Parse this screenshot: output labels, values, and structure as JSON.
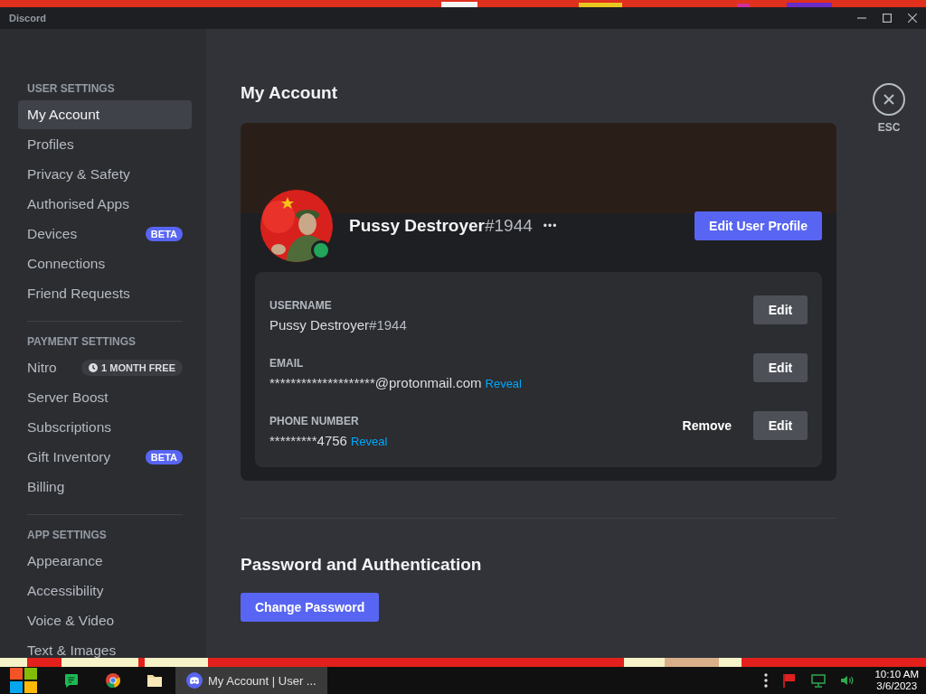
{
  "window": {
    "title": "Discord"
  },
  "sidebar": {
    "sections": [
      {
        "header": "USER SETTINGS",
        "items": [
          {
            "label": "My Account",
            "selected": true
          },
          {
            "label": "Profiles",
            "selected": false
          },
          {
            "label": "Privacy & Safety",
            "selected": false
          },
          {
            "label": "Authorised Apps",
            "selected": false
          },
          {
            "label": "Devices",
            "selected": false,
            "badge": {
              "kind": "beta",
              "text": "BETA"
            }
          },
          {
            "label": "Connections",
            "selected": false
          },
          {
            "label": "Friend Requests",
            "selected": false
          }
        ]
      },
      {
        "header": "PAYMENT SETTINGS",
        "items": [
          {
            "label": "Nitro",
            "selected": false,
            "badge": {
              "kind": "offer",
              "text": "1 MONTH FREE"
            }
          },
          {
            "label": "Server Boost",
            "selected": false
          },
          {
            "label": "Subscriptions",
            "selected": false
          },
          {
            "label": "Gift Inventory",
            "selected": false,
            "badge": {
              "kind": "beta",
              "text": "BETA"
            }
          },
          {
            "label": "Billing",
            "selected": false
          }
        ]
      },
      {
        "header": "APP SETTINGS",
        "items": [
          {
            "label": "Appearance",
            "selected": false
          },
          {
            "label": "Accessibility",
            "selected": false
          },
          {
            "label": "Voice & Video",
            "selected": false
          },
          {
            "label": "Text & Images",
            "selected": false
          }
        ]
      }
    ]
  },
  "page": {
    "title": "My Account",
    "close": {
      "label": "ESC"
    },
    "profile": {
      "name": "Pussy Destroyer",
      "tag": "#1944",
      "more": "•••",
      "edit_button": "Edit User Profile"
    },
    "fields": [
      {
        "label": "USERNAME",
        "value": "Pussy Destroyer",
        "value_tag": "#1944",
        "buttons": [
          {
            "label": "Edit",
            "kind": "secondary"
          }
        ]
      },
      {
        "label": "EMAIL",
        "value": "********************@protonmail.com",
        "reveal": "Reveal",
        "buttons": [
          {
            "label": "Edit",
            "kind": "secondary"
          }
        ]
      },
      {
        "label": "PHONE NUMBER",
        "value": "*********4756",
        "reveal": "Reveal",
        "buttons": [
          {
            "label": "Remove",
            "kind": "link"
          },
          {
            "label": "Edit",
            "kind": "secondary"
          }
        ]
      }
    ],
    "security": {
      "title": "Password and Authentication",
      "button": "Change Password"
    }
  },
  "taskbar": {
    "apps": [
      {
        "kind": "chat",
        "selected": false
      },
      {
        "kind": "browser",
        "selected": false
      },
      {
        "kind": "folder",
        "selected": false
      },
      {
        "kind": "discord",
        "label": "My Account | User ...",
        "selected": true
      }
    ],
    "clock": {
      "time": "10:10 AM",
      "date": "3/6/2023"
    }
  }
}
